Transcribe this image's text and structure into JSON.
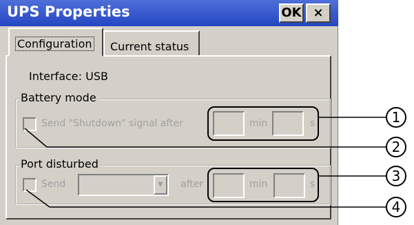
{
  "window": {
    "title": "UPS Properties",
    "ok_label": "OK",
    "close_label": "×"
  },
  "tabs": [
    {
      "label": "Configuration",
      "active": true
    },
    {
      "label": "Current status",
      "active": false
    }
  ],
  "interface_text": "Interface: USB",
  "battery_mode": {
    "legend": "Battery mode",
    "send_label": "Send \"Shutdown\" signal after",
    "unit_min": "min",
    "unit_s": "s",
    "minutes_value": "",
    "seconds_value": ""
  },
  "port_disturbed": {
    "legend": "Port disturbed",
    "send_label": "Send",
    "dropdown_value": "",
    "after_label": "after",
    "unit_min": "min",
    "unit_s": "s",
    "minutes_value": "",
    "seconds_value": ""
  },
  "callouts": [
    "1",
    "2",
    "3",
    "4"
  ]
}
